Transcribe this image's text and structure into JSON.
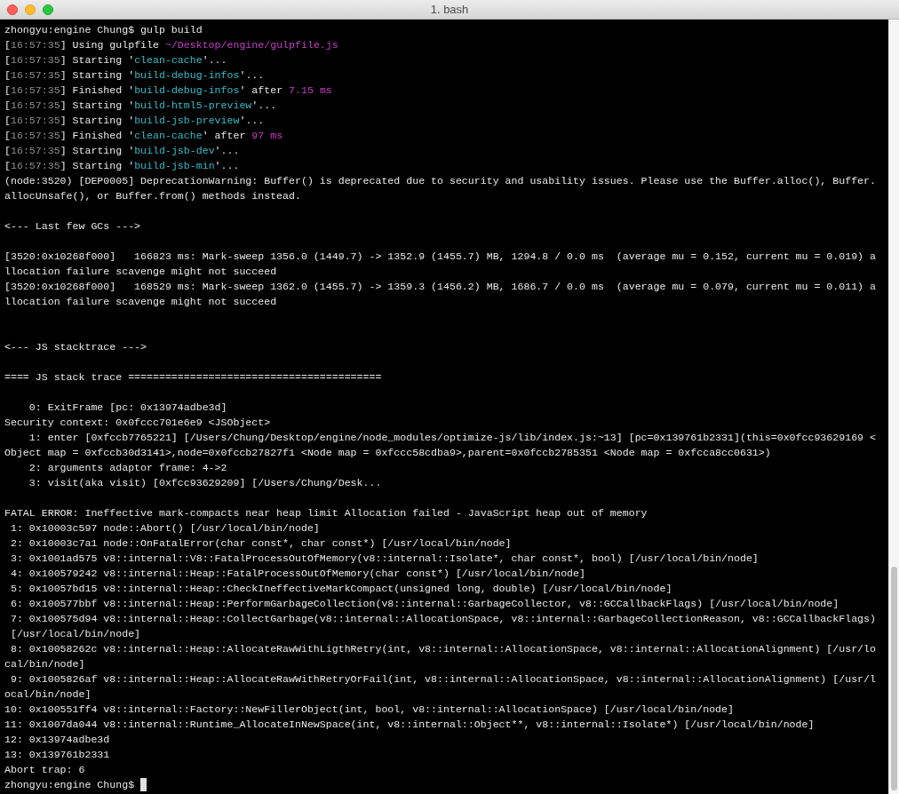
{
  "window": {
    "title": "1. bash"
  },
  "terminal": {
    "lines": [
      {
        "kind": "text",
        "text": "zhongyu:engine Chung$ gulp build"
      },
      {
        "kind": "log",
        "segments": [
          {
            "kind": "plain",
            "text": "["
          },
          {
            "kind": "time",
            "text": "16:57:35"
          },
          {
            "kind": "plain",
            "text": "] Using gulpfile "
          },
          {
            "kind": "path",
            "text": "~/Desktop/engine/gulpfile.js"
          }
        ]
      },
      {
        "kind": "log",
        "segments": [
          {
            "kind": "plain",
            "text": "["
          },
          {
            "kind": "time",
            "text": "16:57:35"
          },
          {
            "kind": "plain",
            "text": "] Starting '"
          },
          {
            "kind": "name",
            "text": "clean-cache"
          },
          {
            "kind": "plain",
            "text": "'..."
          }
        ]
      },
      {
        "kind": "log",
        "segments": [
          {
            "kind": "plain",
            "text": "["
          },
          {
            "kind": "time",
            "text": "16:57:35"
          },
          {
            "kind": "plain",
            "text": "] Starting '"
          },
          {
            "kind": "name",
            "text": "build-debug-infos"
          },
          {
            "kind": "plain",
            "text": "'..."
          }
        ]
      },
      {
        "kind": "log",
        "segments": [
          {
            "kind": "plain",
            "text": "["
          },
          {
            "kind": "time",
            "text": "16:57:35"
          },
          {
            "kind": "plain",
            "text": "] Finished '"
          },
          {
            "kind": "name",
            "text": "build-debug-infos"
          },
          {
            "kind": "plain",
            "text": "' after "
          },
          {
            "kind": "value",
            "text": "7.15 ms"
          }
        ]
      },
      {
        "kind": "log",
        "segments": [
          {
            "kind": "plain",
            "text": "["
          },
          {
            "kind": "time",
            "text": "16:57:35"
          },
          {
            "kind": "plain",
            "text": "] Starting '"
          },
          {
            "kind": "name",
            "text": "build-html5-preview"
          },
          {
            "kind": "plain",
            "text": "'..."
          }
        ]
      },
      {
        "kind": "log",
        "segments": [
          {
            "kind": "plain",
            "text": "["
          },
          {
            "kind": "time",
            "text": "16:57:35"
          },
          {
            "kind": "plain",
            "text": "] Starting '"
          },
          {
            "kind": "name",
            "text": "build-jsb-preview"
          },
          {
            "kind": "plain",
            "text": "'..."
          }
        ]
      },
      {
        "kind": "log",
        "segments": [
          {
            "kind": "plain",
            "text": "["
          },
          {
            "kind": "time",
            "text": "16:57:35"
          },
          {
            "kind": "plain",
            "text": "] Finished '"
          },
          {
            "kind": "name",
            "text": "clean-cache"
          },
          {
            "kind": "plain",
            "text": "' after "
          },
          {
            "kind": "value",
            "text": "97 ms"
          }
        ]
      },
      {
        "kind": "log",
        "segments": [
          {
            "kind": "plain",
            "text": "["
          },
          {
            "kind": "time",
            "text": "16:57:35"
          },
          {
            "kind": "plain",
            "text": "] Starting '"
          },
          {
            "kind": "name",
            "text": "build-jsb-dev"
          },
          {
            "kind": "plain",
            "text": "'..."
          }
        ]
      },
      {
        "kind": "log",
        "segments": [
          {
            "kind": "plain",
            "text": "["
          },
          {
            "kind": "time",
            "text": "16:57:35"
          },
          {
            "kind": "plain",
            "text": "] Starting '"
          },
          {
            "kind": "name",
            "text": "build-jsb-min"
          },
          {
            "kind": "plain",
            "text": "'..."
          }
        ]
      },
      {
        "kind": "text",
        "text": "(node:3520) [DEP0005] DeprecationWarning: Buffer() is deprecated due to security and usability issues. Please use the Buffer.alloc(), Buffer."
      },
      {
        "kind": "text",
        "text": "allocUnsafe(), or Buffer.from() methods instead."
      },
      {
        "kind": "blank"
      },
      {
        "kind": "text",
        "text": "<--- Last few GCs --->"
      },
      {
        "kind": "blank"
      },
      {
        "kind": "text",
        "text": "[3520:0x10268f000]   166823 ms: Mark-sweep 1356.0 (1449.7) -> 1352.9 (1455.7) MB, 1294.8 / 0.0 ms  (average mu = 0.152, current mu = 0.019) a"
      },
      {
        "kind": "text",
        "text": "llocation failure scavenge might not succeed"
      },
      {
        "kind": "text",
        "text": "[3520:0x10268f000]   168529 ms: Mark-sweep 1362.0 (1455.7) -> 1359.3 (1456.2) MB, 1686.7 / 0.0 ms  (average mu = 0.079, current mu = 0.011) a"
      },
      {
        "kind": "text",
        "text": "llocation failure scavenge might not succeed"
      },
      {
        "kind": "blank"
      },
      {
        "kind": "blank"
      },
      {
        "kind": "text",
        "text": "<--- JS stacktrace --->"
      },
      {
        "kind": "blank"
      },
      {
        "kind": "text",
        "text": "==== JS stack trace ========================================="
      },
      {
        "kind": "blank"
      },
      {
        "kind": "text",
        "text": "    0: ExitFrame [pc: 0x13974adbe3d]"
      },
      {
        "kind": "text",
        "text": "Security context: 0x0fccc701e6e9 <JSObject>"
      },
      {
        "kind": "text",
        "text": "    1: enter [0xfccb7765221] [/Users/Chung/Desktop/engine/node_modules/optimize-js/lib/index.js:~13] [pc=0x139761b2331](this=0x0fcc93629169 <"
      },
      {
        "kind": "text",
        "text": "Object map = 0xfccb30d3141>,node=0x0fccb27827f1 <Node map = 0xfccc58cdba9>,parent=0x0fccb2785351 <Node map = 0xfcca8cc0631>)"
      },
      {
        "kind": "text",
        "text": "    2: arguments adaptor frame: 4->2"
      },
      {
        "kind": "text",
        "text": "    3: visit(aka visit) [0xfcc93629209] [/Users/Chung/Desk..."
      },
      {
        "kind": "blank"
      },
      {
        "kind": "text",
        "text": "FATAL ERROR: Ineffective mark-compacts near heap limit Allocation failed - JavaScript heap out of memory"
      },
      {
        "kind": "text",
        "text": " 1: 0x10003c597 node::Abort() [/usr/local/bin/node]"
      },
      {
        "kind": "text",
        "text": " 2: 0x10003c7a1 node::OnFatalError(char const*, char const*) [/usr/local/bin/node]"
      },
      {
        "kind": "text",
        "text": " 3: 0x1001ad575 v8::internal::V8::FatalProcessOutOfMemory(v8::internal::Isolate*, char const*, bool) [/usr/local/bin/node]"
      },
      {
        "kind": "text",
        "text": " 4: 0x100579242 v8::internal::Heap::FatalProcessOutOfMemory(char const*) [/usr/local/bin/node]"
      },
      {
        "kind": "text",
        "text": " 5: 0x10057bd15 v8::internal::Heap::CheckIneffectiveMarkCompact(unsigned long, double) [/usr/local/bin/node]"
      },
      {
        "kind": "text",
        "text": " 6: 0x100577bbf v8::internal::Heap::PerformGarbageCollection(v8::internal::GarbageCollector, v8::GCCallbackFlags) [/usr/local/bin/node]"
      },
      {
        "kind": "text",
        "text": " 7: 0x100575d94 v8::internal::Heap::CollectGarbage(v8::internal::AllocationSpace, v8::internal::GarbageCollectionReason, v8::GCCallbackFlags)"
      },
      {
        "kind": "text",
        "text": " [/usr/local/bin/node]"
      },
      {
        "kind": "text",
        "text": " 8: 0x10058262c v8::internal::Heap::AllocateRawWithLigthRetry(int, v8::internal::AllocationSpace, v8::internal::AllocationAlignment) [/usr/lo"
      },
      {
        "kind": "text",
        "text": "cal/bin/node]"
      },
      {
        "kind": "text",
        "text": " 9: 0x1005826af v8::internal::Heap::AllocateRawWithRetryOrFail(int, v8::internal::AllocationSpace, v8::internal::AllocationAlignment) [/usr/l"
      },
      {
        "kind": "text",
        "text": "ocal/bin/node]"
      },
      {
        "kind": "text",
        "text": "10: 0x100551ff4 v8::internal::Factory::NewFillerObject(int, bool, v8::internal::AllocationSpace) [/usr/local/bin/node]"
      },
      {
        "kind": "text",
        "text": "11: 0x1007da044 v8::internal::Runtime_AllocateInNewSpace(int, v8::internal::Object**, v8::internal::Isolate*) [/usr/local/bin/node]"
      },
      {
        "kind": "text",
        "text": "12: 0x13974adbe3d"
      },
      {
        "kind": "text",
        "text": "13: 0x139761b2331"
      },
      {
        "kind": "text",
        "text": "Abort trap: 6"
      },
      {
        "kind": "prompt",
        "text": "zhongyu:engine Chung$",
        "cursor": true
      }
    ]
  }
}
